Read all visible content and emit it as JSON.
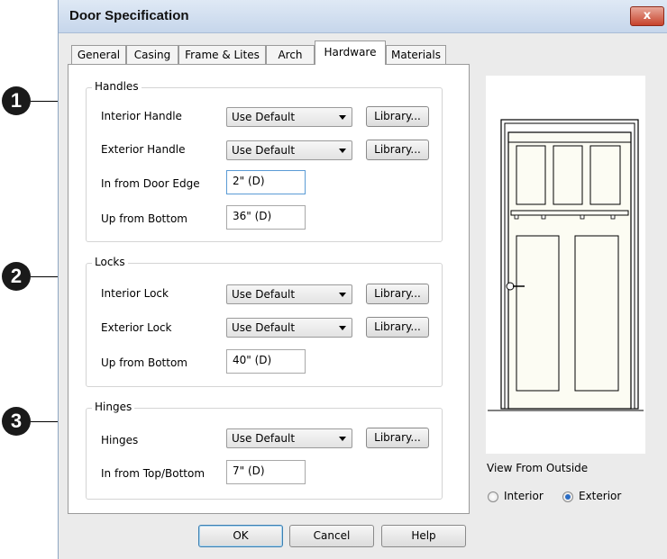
{
  "window": {
    "title": "Door Specification",
    "close_glyph": "x"
  },
  "tabs": [
    {
      "label": "General"
    },
    {
      "label": "Casing"
    },
    {
      "label": "Frame & Lites"
    },
    {
      "label": "Arch"
    },
    {
      "label": "Hardware",
      "active": true
    },
    {
      "label": "Materials"
    }
  ],
  "callouts": [
    "1",
    "2",
    "3"
  ],
  "handles": {
    "legend": "Handles",
    "interior_label": "Interior Handle",
    "interior_value": "Use Default",
    "exterior_label": "Exterior Handle",
    "exterior_value": "Use Default",
    "edge_label": "In from Door Edge",
    "edge_value": "2\" (D)",
    "up_label": "Up from Bottom",
    "up_value": "36\" (D)"
  },
  "locks": {
    "legend": "Locks",
    "interior_label": "Interior Lock",
    "interior_value": "Use Default",
    "exterior_label": "Exterior Lock",
    "exterior_value": "Use Default",
    "up_label": "Up from Bottom",
    "up_value": "40\" (D)"
  },
  "hinges": {
    "legend": "Hinges",
    "hinges_label": "Hinges",
    "hinges_value": "Use Default",
    "topbottom_label": "In from Top/Bottom",
    "topbottom_value": "7\" (D)"
  },
  "library_label": "Library...",
  "view": {
    "label": "View From Outside",
    "interior_label": "Interior",
    "exterior_label": "Exterior",
    "selected": "Exterior"
  },
  "footer": {
    "ok_label": "OK",
    "cancel_label": "Cancel",
    "help_label": "Help"
  },
  "colors": {
    "door_fill": "#fcfcf3",
    "door_stroke": "#000000",
    "dialog_bg": "#ebebeb"
  }
}
